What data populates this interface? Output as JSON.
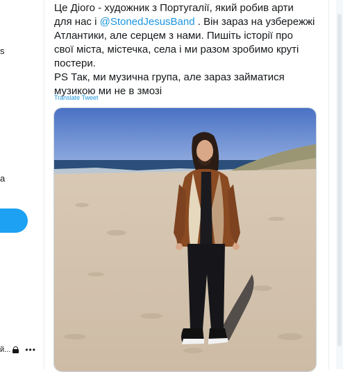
{
  "left_column": {
    "fragment_s": "s",
    "fragment_a": "a",
    "bottom_fragment": "й...",
    "more_icon": "more-dots-icon",
    "lock_icon": "lock-icon"
  },
  "tweet": {
    "line1": "Це Діого - художник з Португалії, який робив арти",
    "line2_pre": "для нас і ",
    "mention": "@StonedJesusBand",
    "line2_post": " . Він зараз на узбережжі",
    "line3": "Атлантики, але серцем з нами. Пишіть історії про",
    "line4": "свої міста, містечка, села і ми разом зробимо круті",
    "line5": "постери.",
    "line6": "PS Так, ми музична група, але зараз займатися",
    "line7": "музикою ми не в змозі",
    "translate_label": "Translate Tweet"
  },
  "colors": {
    "link": "#1b95e0",
    "brand": "#1da1f2",
    "text": "#14171a"
  }
}
